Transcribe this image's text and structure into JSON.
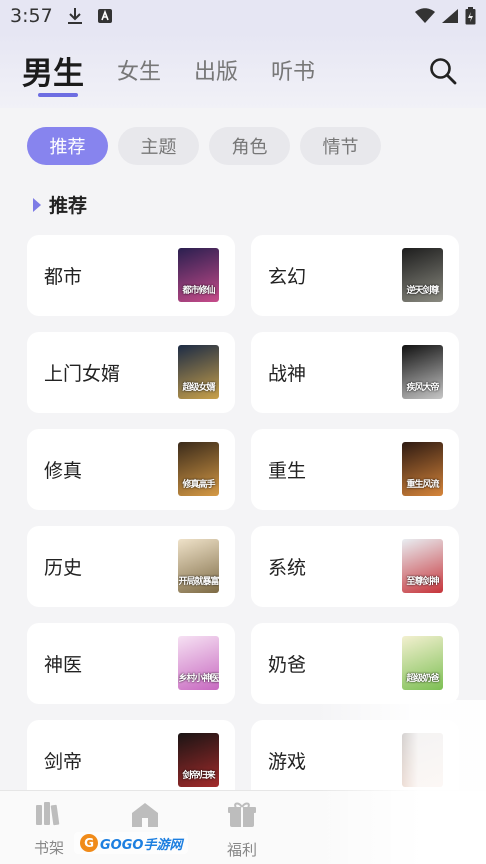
{
  "status_bar": {
    "time": "3:57",
    "icons": [
      "download-icon",
      "a-badge-icon",
      "wifi-icon",
      "signal-icon",
      "battery-icon"
    ]
  },
  "header": {
    "tabs": [
      {
        "label": "男生",
        "active": true
      },
      {
        "label": "女生",
        "active": false
      },
      {
        "label": "出版",
        "active": false
      },
      {
        "label": "听书",
        "active": false
      }
    ],
    "search_icon": "search-icon"
  },
  "chips": [
    {
      "label": "推荐",
      "active": true
    },
    {
      "label": "主题",
      "active": false
    },
    {
      "label": "角色",
      "active": false
    },
    {
      "label": "情节",
      "active": false
    }
  ],
  "section": {
    "title": "推荐"
  },
  "categories": [
    {
      "label": "都市",
      "cover_text": "都市修仙",
      "cover_colors": [
        "#2a1f4f",
        "#c74b8a"
      ]
    },
    {
      "label": "玄幻",
      "cover_text": "逆天剑尊",
      "cover_colors": [
        "#1d1d1d",
        "#8a8a80"
      ]
    },
    {
      "label": "上门女婿",
      "cover_text": "超级女婿",
      "cover_colors": [
        "#1c2b45",
        "#c9a14a"
      ]
    },
    {
      "label": "战神",
      "cover_text": "疾风大帝",
      "cover_colors": [
        "#111111",
        "#c7c7c7"
      ]
    },
    {
      "label": "修真",
      "cover_text": "修真高手",
      "cover_colors": [
        "#3a2a1a",
        "#d69a45"
      ]
    },
    {
      "label": "重生",
      "cover_text": "重生风流",
      "cover_colors": [
        "#2e1a12",
        "#d6853a"
      ]
    },
    {
      "label": "历史",
      "cover_text": "开局就暴富",
      "cover_colors": [
        "#efe2c9",
        "#7d6a44"
      ]
    },
    {
      "label": "系统",
      "cover_text": "至尊剑神",
      "cover_colors": [
        "#e9eef2",
        "#c6343a"
      ]
    },
    {
      "label": "神医",
      "cover_text": "乡村小神医",
      "cover_colors": [
        "#f6e1f3",
        "#c768c0"
      ]
    },
    {
      "label": "奶爸",
      "cover_text": "超级奶爸",
      "cover_colors": [
        "#f3f0d0",
        "#7cbf53"
      ]
    },
    {
      "label": "剑帝",
      "cover_text": "剑帝归来",
      "cover_colors": [
        "#1a1414",
        "#a32b2b"
      ]
    },
    {
      "label": "游戏",
      "cover_text": "",
      "cover_colors": [
        "#2b1a14",
        "#c96a3a"
      ]
    }
  ],
  "bottom_nav": [
    {
      "label": "书架",
      "icon": "bookshelf-icon"
    },
    {
      "label": "",
      "icon": "home-icon"
    },
    {
      "label": "福利",
      "icon": "gift-icon"
    }
  ],
  "watermark": {
    "text": "GOGO手游网",
    "badge": "G"
  }
}
